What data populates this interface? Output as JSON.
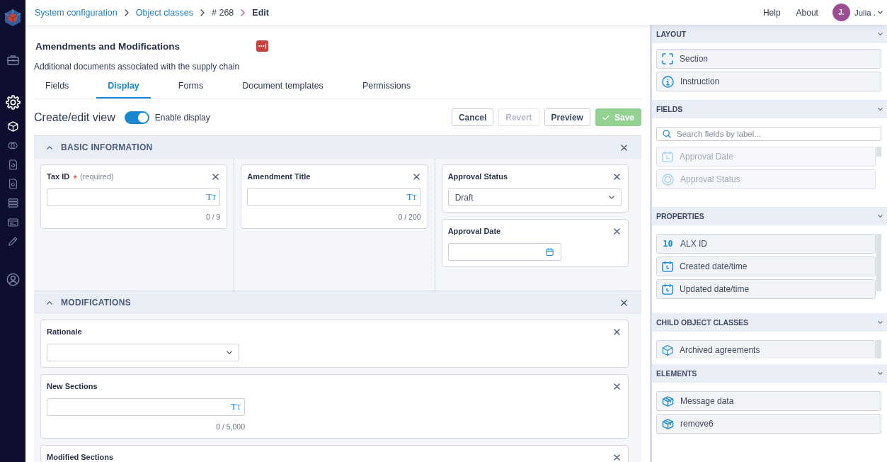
{
  "nav_rail": {
    "items": [
      {
        "selected": false
      },
      {
        "selected": true
      },
      {
        "selected": true
      },
      {
        "selected": false
      },
      {
        "selected": false
      },
      {
        "selected": false
      },
      {
        "selected": false
      },
      {
        "selected": false
      },
      {
        "selected": false
      },
      {
        "selected": false
      }
    ]
  },
  "header": {
    "breadcrumb": [
      {
        "label": "System configuration",
        "kind": "link"
      },
      {
        "label": "Object classes",
        "kind": "link"
      },
      {
        "label": "# 268",
        "kind": "text"
      },
      {
        "label": "Edit",
        "kind": "current"
      }
    ],
    "links": [
      "Help",
      "About"
    ],
    "user": {
      "initials": "J.",
      "name": "Julia ."
    }
  },
  "object": {
    "title": "Amendments and Modifications",
    "description": "Additional documents associated with the supply chain"
  },
  "tabs": [
    {
      "label": "Fields",
      "selected": false
    },
    {
      "label": "Display",
      "selected": true
    },
    {
      "label": "Forms",
      "selected": false
    },
    {
      "label": "Document templates",
      "selected": false
    },
    {
      "label": "Permissions",
      "selected": false
    }
  ],
  "view": {
    "title": "Create/edit view",
    "toggle": {
      "label": "Enable display",
      "on": true
    },
    "buttons": [
      {
        "label": "Cancel",
        "kind": "default",
        "disabled": false
      },
      {
        "label": "Revert",
        "kind": "default",
        "disabled": true
      },
      {
        "label": "Preview",
        "kind": "default",
        "disabled": false
      },
      {
        "label": "Save",
        "kind": "primary",
        "disabled": true
      }
    ]
  },
  "sections": [
    {
      "title": "BASIC INFORMATION",
      "expanded": true,
      "columns": [
        [
          {
            "label": "Tax ID",
            "marker": "*",
            "note": "(required)",
            "kind": "text",
            "glyph": "TT",
            "counter": "0 / 9"
          }
        ],
        [
          {
            "label": "Amendment Title",
            "kind": "text",
            "glyph": "TT",
            "counter": "0 / 200"
          }
        ],
        [
          {
            "label": "Approval Status",
            "kind": "select",
            "value": "Draft"
          },
          {
            "label": "Approval Date",
            "kind": "date"
          }
        ]
      ]
    },
    {
      "title": "MODIFICATIONS",
      "expanded": true,
      "columns": [
        [
          {
            "label": "Rationale",
            "kind": "select"
          },
          {
            "label": "New Sections",
            "kind": "text",
            "glyph": "TT",
            "counter": "0 / 5,000"
          },
          {
            "label": "Modified Sections"
          }
        ]
      ]
    }
  ],
  "palette": {
    "groups": [
      {
        "title": "LAYOUT",
        "items": [
          {
            "label": "Section",
            "kind": "section"
          },
          {
            "label": "Instruction",
            "kind": "instruction"
          }
        ]
      },
      {
        "title": "FIELDS",
        "search": {
          "placeholder": "Search fields by label..."
        },
        "items": [
          {
            "label": "Approval Date",
            "kind": "date",
            "disabled": true
          },
          {
            "label": "Approval Status",
            "kind": "status",
            "disabled": true
          }
        ]
      },
      {
        "title": "PROPERTIES",
        "items": [
          {
            "label": "ALX ID",
            "kind": "number",
            "glyph": "10"
          },
          {
            "label": "Created date/time",
            "kind": "date"
          },
          {
            "label": "Updated date/time",
            "kind": "date"
          }
        ]
      },
      {
        "title": "CHILD OBJECT CLASSES",
        "items": [
          {
            "label": "Archived agreements",
            "kind": "object"
          }
        ]
      },
      {
        "title": "ELEMENTS",
        "items": [
          {
            "label": "Message data",
            "kind": "element"
          },
          {
            "label": "remove6",
            "kind": "element"
          }
        ]
      }
    ]
  }
}
